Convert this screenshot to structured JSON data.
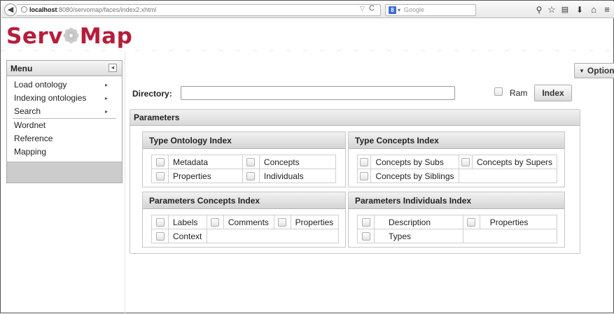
{
  "browser": {
    "url_host": "localhost",
    "url_rest": ":8080/servomap/faces/index2.xhtml",
    "search_placeholder": "Google",
    "search_badge": "8"
  },
  "app": {
    "logo_part1": "Serv",
    "logo_part2": "Map"
  },
  "sidebar": {
    "title": "Menu",
    "items": [
      {
        "label": "Load ontology"
      },
      {
        "label": "Indexing ontologies"
      },
      {
        "label": "Search"
      },
      {
        "label": "Wordnet"
      },
      {
        "label": "Reference"
      },
      {
        "label": "Mapping"
      }
    ]
  },
  "toolbar": {
    "options_label": "Options"
  },
  "form": {
    "directory_label": "Directory:",
    "directory_value": "",
    "ram_label": "Ram",
    "index_button": "Index"
  },
  "parameters": {
    "title": "Parameters",
    "type_ontology": {
      "title": "Type Ontology Index",
      "options": [
        "Metadata",
        "Concepts",
        "Properties",
        "Individuals"
      ]
    },
    "type_concepts": {
      "title": "Type Concepts Index",
      "options": [
        "Concepts by Subs",
        "Concepts by Supers",
        "Concepts by Siblings"
      ]
    },
    "params_concepts": {
      "title": "Parameters Concepts Index",
      "options": [
        "Labels",
        "Comments",
        "Properties",
        "Context"
      ]
    },
    "params_individuals": {
      "title": "Parameters Individuals Index",
      "options": [
        "Description",
        "Properties",
        "Types"
      ]
    }
  }
}
